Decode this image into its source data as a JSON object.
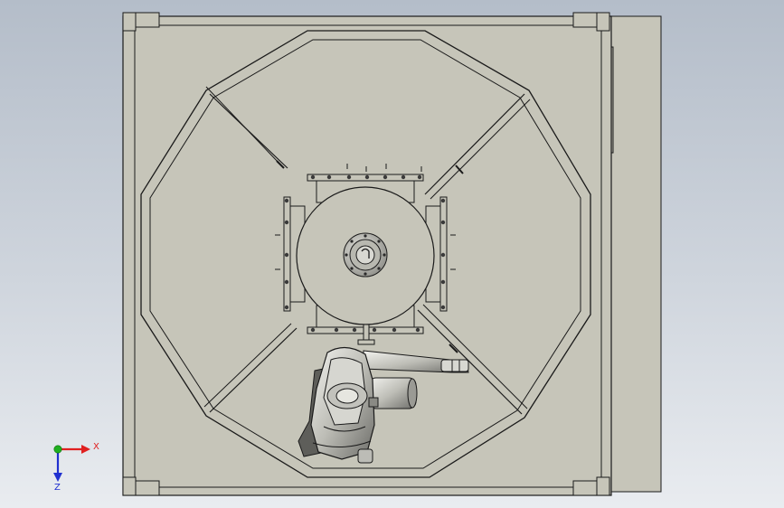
{
  "view": {
    "orientation": "top-view",
    "background_top": "#b4bdc9",
    "background_bottom": "#e9ecf0"
  },
  "colors": {
    "plate": "#c6c5b9",
    "plate_dark": "#b3b2a5",
    "line": "#1a1a1a",
    "robot_light": "#e8e8e3",
    "robot_dark": "#6e6e6a",
    "axis_x": "#e02020",
    "axis_y": "#20b020",
    "axis_z": "#2030d0"
  },
  "triad": {
    "x_label": "X",
    "z_label": "Z",
    "x_icon": "x-axis-arrow-icon",
    "y_icon": "y-axis-dot-icon",
    "z_icon": "z-axis-arrow-icon"
  }
}
